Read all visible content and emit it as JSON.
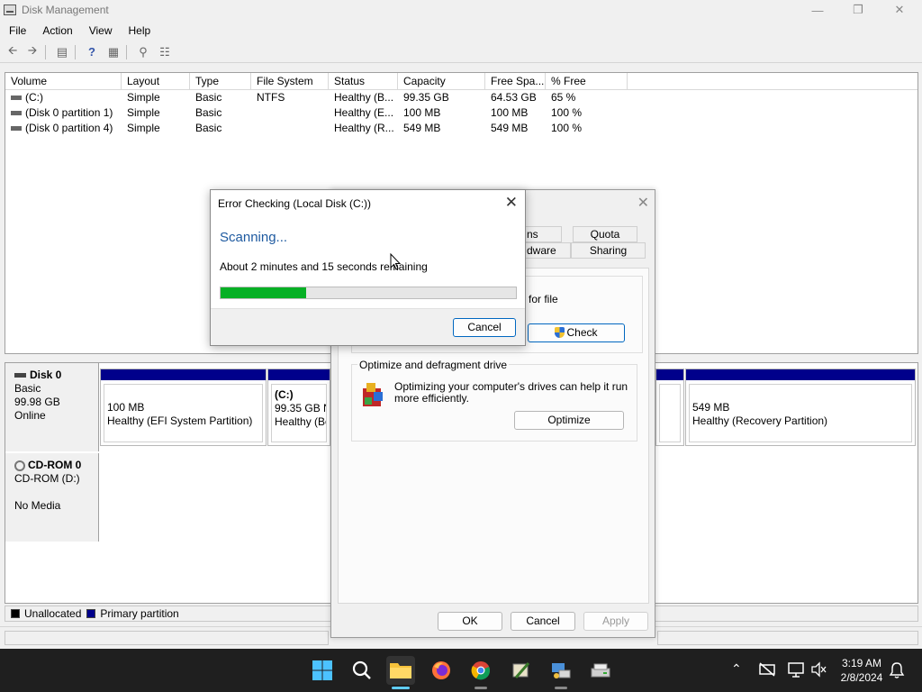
{
  "window": {
    "title": "Disk Management"
  },
  "menu": [
    "File",
    "Action",
    "View",
    "Help"
  ],
  "volume_list": {
    "columns": [
      "Volume",
      "Layout",
      "Type",
      "File System",
      "Status",
      "Capacity",
      "Free Spa...",
      "% Free"
    ],
    "rows": [
      [
        "(C:)",
        "Simple",
        "Basic",
        "NTFS",
        "Healthy (B...",
        "99.35 GB",
        "64.53 GB",
        "65 %"
      ],
      [
        "(Disk 0 partition 1)",
        "Simple",
        "Basic",
        "",
        "Healthy (E...",
        "100 MB",
        "100 MB",
        "100 %"
      ],
      [
        "(Disk 0 partition 4)",
        "Simple",
        "Basic",
        "",
        "Healthy (R...",
        "549 MB",
        "549 MB",
        "100 %"
      ]
    ]
  },
  "disks": {
    "disk0": {
      "name": "Disk 0",
      "type": "Basic",
      "size": "99.98 GB",
      "state": "Online"
    },
    "cdrom0": {
      "name": "CD-ROM 0",
      "type": "CD-ROM (D:)",
      "state": "No Media"
    },
    "partitions": [
      {
        "size": "100 MB",
        "status": "Healthy (EFI System Partition)"
      },
      {
        "label": "(C:)",
        "size": "99.35 GB NT",
        "status": "Healthy (Bo"
      },
      {
        "size": "549 MB",
        "status": "Healthy (Recovery Partition)"
      }
    ]
  },
  "legend": {
    "unallocated": "Unallocated",
    "primary": "Primary partition"
  },
  "properties": {
    "tabs": {
      "t1": "ns",
      "quota": "Quota",
      "hardware": "dware",
      "sharing": "Sharing"
    },
    "error_check_text": "for file",
    "check_button": "Check",
    "optimize_group": "Optimize and defragment drive",
    "optimize_text": "Optimizing your computer's drives can help it run more efficiently.",
    "optimize_button": "Optimize",
    "ok": "OK",
    "cancel": "Cancel",
    "apply": "Apply"
  },
  "error_dialog": {
    "title": "Error Checking (Local Disk (C:))",
    "heading": "Scanning...",
    "message": "About 2 minutes and 15 seconds remaining",
    "progress_fraction": 0.29,
    "cancel": "Cancel"
  },
  "clock": {
    "time": "3:19 AM",
    "date": "2/8/2024"
  },
  "colors": {
    "primary_partition": "#00008b",
    "progress": "#06b025",
    "accent": "#0067c0"
  }
}
